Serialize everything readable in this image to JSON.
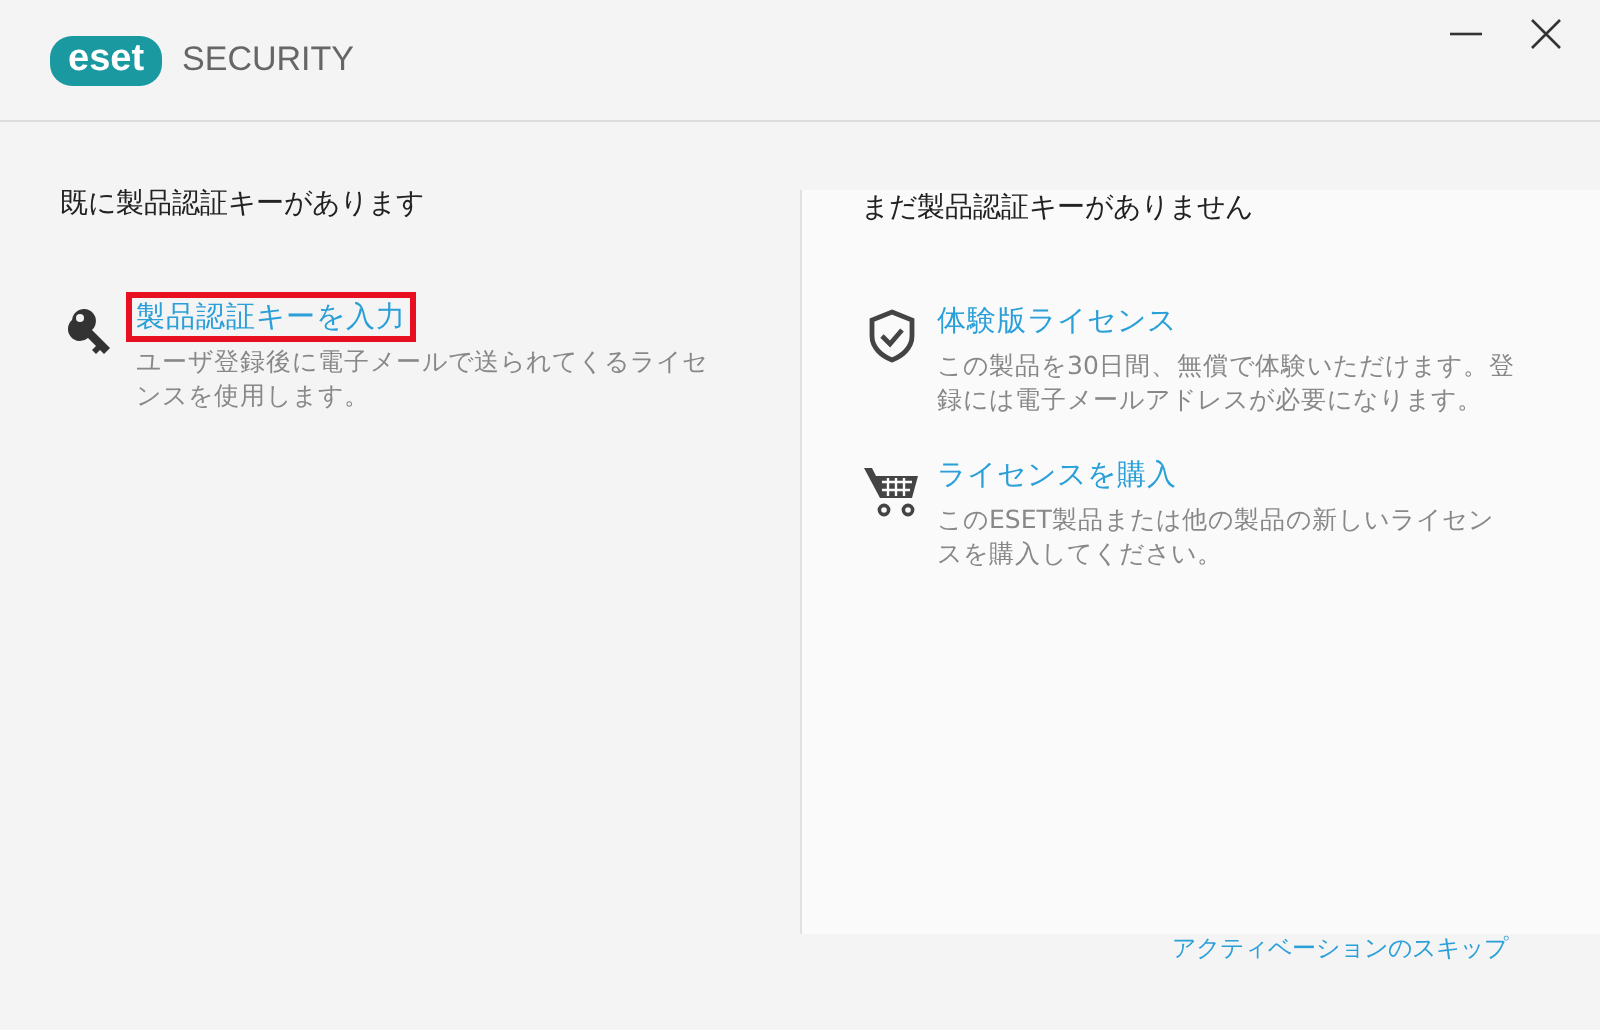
{
  "header": {
    "brand": "eset",
    "product": "SECURITY"
  },
  "columns": [
    {
      "heading": "既に製品認証キーがあります",
      "options": [
        {
          "kind": "key",
          "label": "製品認証キーを入力",
          "highlighted": true,
          "description": "ユーザ登録後に電子メールで送られてくるライセンスを使用します。"
        }
      ]
    },
    {
      "heading": "まだ製品認証キーがありません",
      "options": [
        {
          "kind": "shield",
          "label": "体験版ライセンス",
          "highlighted": false,
          "description": "この製品を30日間、無償で体験いただけます。登録には電子メールアドレスが必要になります。"
        },
        {
          "kind": "cart",
          "label": "ライセンスを購入",
          "highlighted": false,
          "description": "このESET製品または他の製品の新しいライセンスを購入してください。"
        }
      ]
    }
  ],
  "skip_link": "アクティベーションのスキップ"
}
